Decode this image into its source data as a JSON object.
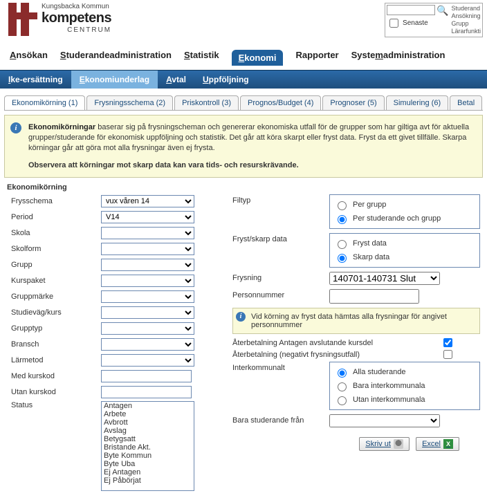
{
  "brand": {
    "line1": "Kungsbacka Kommun",
    "line2": "kompetens",
    "line3": "CENTRUM"
  },
  "search": {
    "senaste": "Senaste",
    "sidelines": [
      "Studerand",
      "Ansökning",
      "Grupp",
      "Lärarfunkti"
    ]
  },
  "mainnav": {
    "items": [
      "Ansökan",
      "Studerandeadministration",
      "Statistik",
      "Ekonomi",
      "Rapporter",
      "Systemadministration"
    ],
    "underline_idx": [
      0,
      0,
      0,
      0,
      -1,
      5
    ],
    "active": 3
  },
  "subnav": {
    "items": [
      "Ike-ersättning",
      "Ekonomiunderlag",
      "Avtal",
      "Uppföljning"
    ],
    "active": 1
  },
  "tabs": {
    "items": [
      "Ekonomikörning (1)",
      "Frysningsschema (2)",
      "Priskontroll (3)",
      "Prognos/Budget (4)",
      "Prognoser (5)",
      "Simulering (6)",
      "Betal"
    ],
    "active": 0
  },
  "info": {
    "title": "Ekonomikörningar",
    "body": " baserar sig på frysningscheman och genererar ekonomiska utfall för de grupper som har giltiga avt för aktuella grupper/studerande för ekonomisk uppföljning och statistik. Det går att köra skarpt eller fryst data. Fryst da ett givet tillfälle. Skarpa körningar går att göra mot alla frysningar även ej frysta.",
    "obs": "Observera att körningar mot skarp data kan vara tids- och resurskrävande."
  },
  "section_title": "Ekonomikörning",
  "left": {
    "labels": {
      "frysschema": "Frysschema",
      "period": "Period",
      "skola": "Skola",
      "skolform": "Skolform",
      "grupp": "Grupp",
      "kurspaket": "Kurspaket",
      "gruppmarke": "Gruppmärke",
      "studievag": "Studieväg/kurs",
      "grupptyp": "Grupptyp",
      "bransch": "Bransch",
      "larmetod": "Lärmetod",
      "medkurskod": "Med kurskod",
      "utankurskod": "Utan kurskod",
      "status": "Status"
    },
    "values": {
      "frysschema": "vux våren 14",
      "period": "V14"
    },
    "status_options": [
      "Antagen",
      "Arbete",
      "Avbrott",
      "Avslag",
      "Betygsatt",
      "Bristande Akt.",
      "Byte Kommun",
      "Byte Uba",
      "Ej Antagen",
      "Ej Påbörjat"
    ]
  },
  "right": {
    "labels": {
      "filtyp": "Filtyp",
      "fryst": "Fryst/skarp data",
      "frysning": "Frysning",
      "personnummer": "Personnummer",
      "aterbet1": "Återbetalning Antagen avslutande kursdel",
      "aterbet2": "Återbetalning (negativt frysningsutfall)",
      "interkom": "Interkommunalt",
      "barastud": "Bara studerande från"
    },
    "filtyp_opts": [
      "Per grupp",
      "Per studerande och grupp"
    ],
    "filtyp_sel": 1,
    "fryst_opts": [
      "Fryst data",
      "Skarp data"
    ],
    "fryst_sel": 1,
    "frysning_val": "140701-140731 Slut",
    "hint": "Vid körning av fryst data hämtas alla frysningar för angivet personnummer",
    "chk1": true,
    "chk2": false,
    "interkom_opts": [
      "Alla studerande",
      "Bara interkommunala",
      "Utan interkommunala"
    ],
    "interkom_sel": 0
  },
  "buttons": {
    "print": "Skriv ut",
    "excel": "Excel"
  }
}
